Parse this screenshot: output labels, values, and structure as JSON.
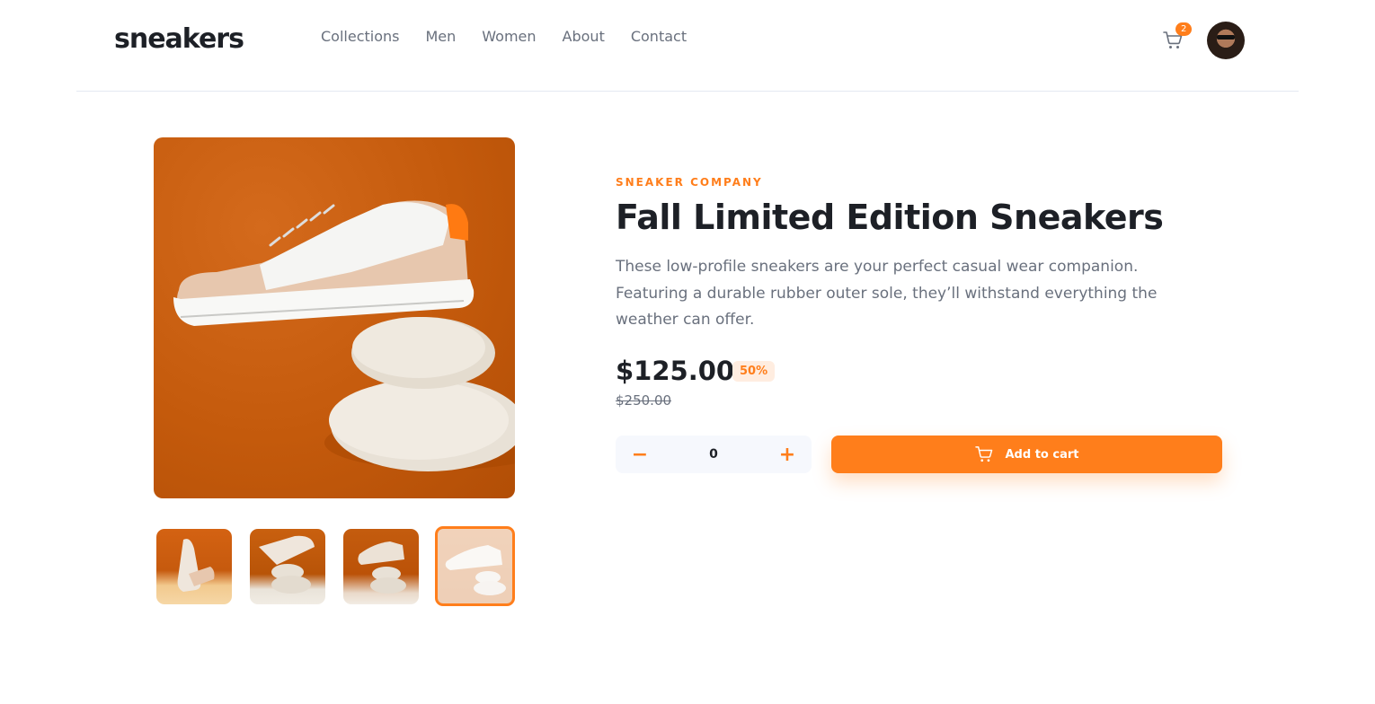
{
  "brand": {
    "logo_text": "sneakers"
  },
  "nav": {
    "items": [
      "Collections",
      "Men",
      "Women",
      "About",
      "Contact"
    ]
  },
  "cart": {
    "count": "2"
  },
  "product": {
    "company": "SNEAKER COMPANY",
    "title": "Fall Limited Edition Sneakers",
    "description": "These low-profile sneakers are your perfect casual wear companion. Featuring a durable rubber outer sole, they’ll withstand everything the weather can offer.",
    "price": "$125.00",
    "discount": "50%",
    "original_price": "$250.00"
  },
  "quantity": {
    "value": "0",
    "minus_symbol": "−",
    "plus_symbol": "+"
  },
  "add_to_cart": {
    "label": "Add to cart"
  },
  "colors": {
    "accent": "#ff7e1b",
    "accent_pale": "#ffede0",
    "text_dark": "#1d2026",
    "text_gray": "#69707d"
  }
}
